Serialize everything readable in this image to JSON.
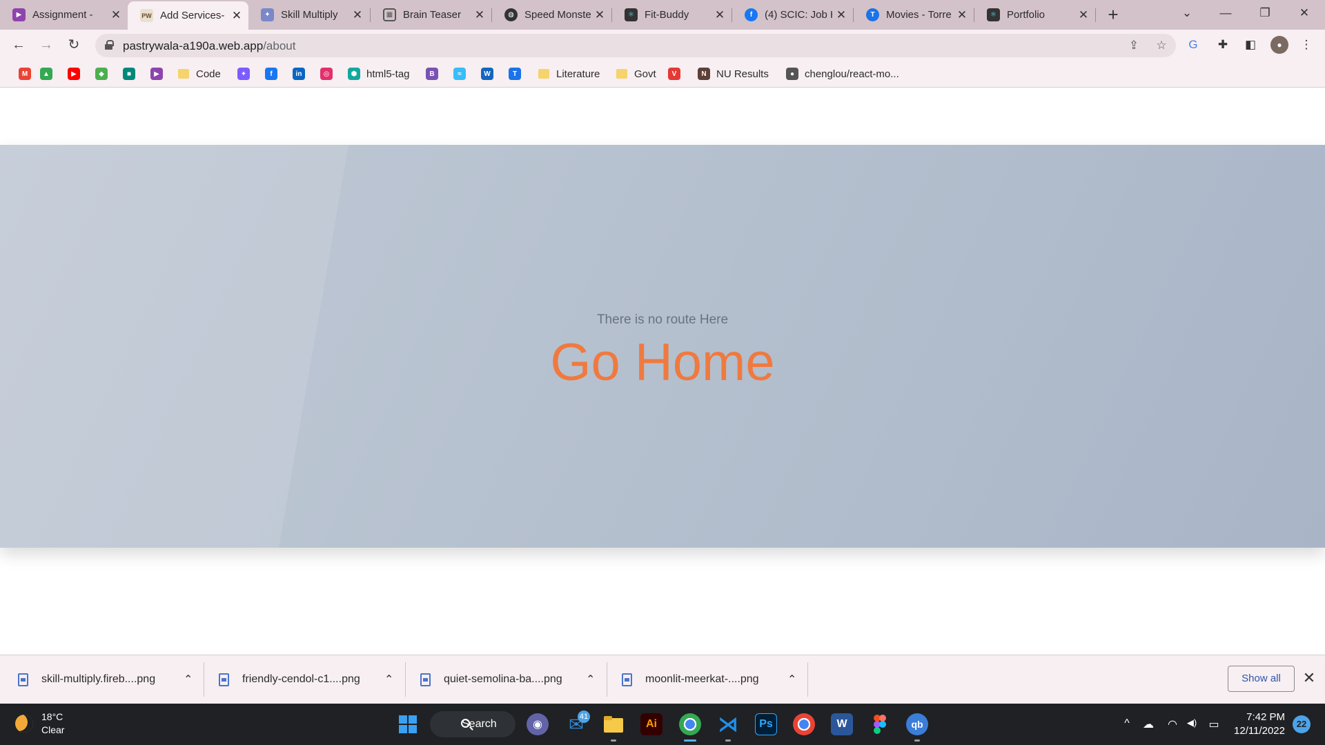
{
  "browser": {
    "tabs": [
      {
        "title": "Assignment - ",
        "favicon": "purple-play-icon",
        "color": "#8e44ad"
      },
      {
        "title": "Add Services-",
        "favicon": "pw-logo-icon",
        "color": "#e8e0d0",
        "active": true
      },
      {
        "title": "Skill Multiply",
        "favicon": "skill-multiply-icon",
        "color": "#7a87c9"
      },
      {
        "title": "Brain Teaser",
        "favicon": "grid-icon",
        "color": "#555555"
      },
      {
        "title": "Speed Monste",
        "favicon": "globe-icon",
        "color": "#333333"
      },
      {
        "title": "Fit-Buddy",
        "favicon": "react-icon",
        "color": "#333333"
      },
      {
        "title": "(4) SCIC: Job H",
        "favicon": "facebook-icon",
        "color": "#1877f2"
      },
      {
        "title": "Movies - Torre",
        "favicon": "t-icon",
        "color": "#1a73e8"
      },
      {
        "title": "Portfolio",
        "favicon": "react-icon",
        "color": "#333333"
      }
    ],
    "tab_close": "✕",
    "new_tab": "+",
    "window_controls": {
      "dropdown": "⌄",
      "minimize": "—",
      "restore": "❐",
      "close": "✕"
    },
    "nav": {
      "back": "←",
      "forward": "→",
      "reload": "↻"
    },
    "address": {
      "domain": "pastrywala-a190a.web.app",
      "path": "/about"
    },
    "bookmarks": [
      {
        "label": "",
        "icon": "gmail-icon",
        "color": "#ea4335",
        "glyph": "M"
      },
      {
        "label": "",
        "icon": "drive-icon",
        "color": "#34a853",
        "glyph": "▲"
      },
      {
        "label": "",
        "icon": "youtube-icon",
        "color": "#ff0000",
        "glyph": "▶"
      },
      {
        "label": "",
        "icon": "maps-icon",
        "color": "#4caf50",
        "glyph": "◆"
      },
      {
        "label": "",
        "icon": "meet-icon",
        "color": "#00897b",
        "glyph": "■"
      },
      {
        "label": "",
        "icon": "purple-play-icon",
        "color": "#8e44ad",
        "glyph": "▶"
      },
      {
        "label": "Code",
        "icon": "folder-icon",
        "color": "#f6d36b",
        "folder": true
      },
      {
        "label": "",
        "icon": "messenger-icon",
        "color": "#7b5cff",
        "glyph": "✦"
      },
      {
        "label": "",
        "icon": "facebook-icon",
        "color": "#1877f2",
        "glyph": "f"
      },
      {
        "label": "",
        "icon": "linkedin-icon",
        "color": "#0a66c2",
        "glyph": "in"
      },
      {
        "label": "",
        "icon": "instagram-icon",
        "color": "#e1306c",
        "glyph": "◎"
      },
      {
        "label": "html5-tag",
        "icon": "html5-tag-icon",
        "color": "#13a89e",
        "glyph": "⬢"
      },
      {
        "label": "",
        "icon": "bootstrap-icon",
        "color": "#7952b3",
        "glyph": "B"
      },
      {
        "label": "",
        "icon": "tailwind-icon",
        "color": "#38bdf8",
        "glyph": "≈"
      },
      {
        "label": "",
        "icon": "w-icon",
        "color": "#1565c0",
        "glyph": "W"
      },
      {
        "label": "",
        "icon": "t-icon",
        "color": "#1a73e8",
        "glyph": "T"
      },
      {
        "label": "Literature",
        "icon": "folder-icon",
        "color": "#f6d36b",
        "folder": true
      },
      {
        "label": "Govt",
        "icon": "folder-icon",
        "color": "#f6d36b",
        "folder": true
      },
      {
        "label": "",
        "icon": "red-v-icon",
        "color": "#e53935",
        "glyph": "V"
      },
      {
        "label": "NU Results",
        "icon": "nu-icon",
        "color": "#5d4037",
        "glyph": "N"
      },
      {
        "label": "chenglou/react-mo...",
        "icon": "github-icon",
        "color": "#555555",
        "glyph": "●"
      }
    ]
  },
  "page": {
    "subtitle": "There is no route Here",
    "home_link": "Go Home"
  },
  "downloads": {
    "items": [
      {
        "name": "skill-multiply.fireb....png"
      },
      {
        "name": "friendly-cendol-c1....png"
      },
      {
        "name": "quiet-semolina-ba....png"
      },
      {
        "name": "moonlit-meerkat-....png"
      }
    ],
    "chevron": "⌃",
    "show_all": "Show all",
    "close": "✕"
  },
  "taskbar": {
    "weather": {
      "temp": "18°C",
      "condition": "Clear"
    },
    "search_label": "Search",
    "apps": [
      {
        "name": "start-icon",
        "glyph": "⊞",
        "color": "#3aa0f3"
      },
      {
        "name": "teams-chat-icon",
        "glyph": "◉",
        "color": "#6264a7"
      },
      {
        "name": "mail-icon",
        "glyph": "✉",
        "color": "#2b88d8",
        "badge": "41"
      },
      {
        "name": "file-explorer-icon",
        "glyph": "▆",
        "color": "#f7c948"
      },
      {
        "name": "illustrator-icon",
        "glyph": "Ai",
        "color": "#330000"
      },
      {
        "name": "chrome-icon",
        "glyph": "◉",
        "color": "#34a853"
      },
      {
        "name": "vscode-icon",
        "glyph": "≺",
        "color": "#007acc"
      },
      {
        "name": "photoshop-icon",
        "glyph": "Ps",
        "color": "#001e36"
      },
      {
        "name": "chrome-profile-icon",
        "glyph": "◉",
        "color": "#34a853"
      },
      {
        "name": "word-icon",
        "glyph": "W",
        "color": "#2b579a"
      },
      {
        "name": "figma-icon",
        "glyph": "✿",
        "color": "#f24e1e"
      },
      {
        "name": "qbittorrent-icon",
        "glyph": "qb",
        "color": "#3b7dd8"
      }
    ],
    "tray": {
      "chevron": "^",
      "onedrive": "☁",
      "wifi": "◠",
      "volume": "◀)",
      "battery": "▭"
    },
    "time": "7:42 PM",
    "date": "12/11/2022",
    "notifications": "22"
  }
}
